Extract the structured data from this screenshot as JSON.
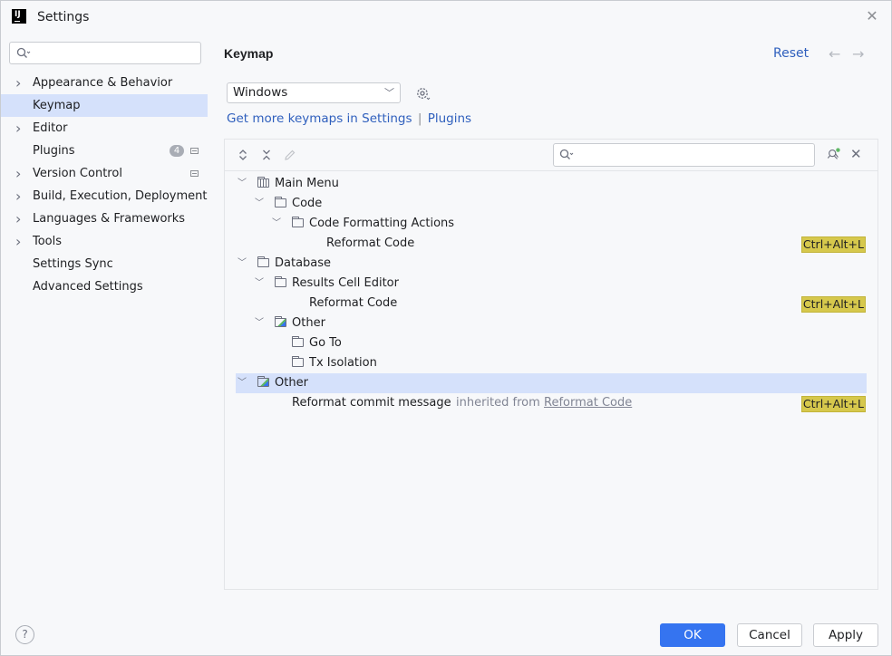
{
  "window": {
    "title": "Settings",
    "app_icon": "IJ"
  },
  "sidebar": {
    "search_placeholder": "",
    "items": [
      {
        "label": "Appearance & Behavior",
        "expandable": true
      },
      {
        "label": "Keymap",
        "selected": true
      },
      {
        "label": "Editor",
        "expandable": true
      },
      {
        "label": "Plugins",
        "badge": "4"
      },
      {
        "label": "Version Control",
        "expandable": true
      },
      {
        "label": "Build, Execution, Deployment",
        "expandable": true
      },
      {
        "label": "Languages & Frameworks",
        "expandable": true
      },
      {
        "label": "Tools",
        "expandable": true
      },
      {
        "label": "Settings Sync"
      },
      {
        "label": "Advanced Settings"
      }
    ]
  },
  "main": {
    "title": "Keymap",
    "reset_label": "Reset",
    "keymap_value": "Windows",
    "more_keymaps_text": "Get more keymaps in Settings",
    "plugins_link": "Plugins",
    "separator": "|"
  },
  "tree": [
    {
      "label": "Main Menu",
      "level": 0,
      "icon": "menu-folder-icon",
      "expanded": true
    },
    {
      "label": "Code",
      "level": 1,
      "icon": "folder-icon",
      "expanded": true
    },
    {
      "label": "Code Formatting Actions",
      "level": 2,
      "icon": "folder-icon",
      "expanded": true
    },
    {
      "label": "Reformat Code",
      "level": 3,
      "shortcut": "Ctrl+Alt+L"
    },
    {
      "label": "Database",
      "level": 0,
      "icon": "folder-icon",
      "expanded": true
    },
    {
      "label": "Results Cell Editor",
      "level": 1,
      "icon": "folder-icon",
      "expanded": true
    },
    {
      "label": "Reformat Code",
      "level": 2,
      "shortcut": "Ctrl+Alt+L"
    },
    {
      "label": "Other",
      "level": 1,
      "icon": "other-folder-icon",
      "expanded": true
    },
    {
      "label": "Go To",
      "level": 2,
      "icon": "folder-icon"
    },
    {
      "label": "Tx Isolation",
      "level": 2,
      "icon": "folder-icon"
    },
    {
      "label": "Other",
      "level": 0,
      "icon": "other-folder-icon",
      "expanded": true,
      "selected": true
    },
    {
      "label": "Reformat commit message",
      "level": 1,
      "note": "inherited from",
      "note_link": "Reformat Code",
      "shortcut": "Ctrl+Alt+L"
    }
  ],
  "footer": {
    "help": "?",
    "ok": "OK",
    "cancel": "Cancel",
    "apply": "Apply"
  },
  "colors": {
    "accent": "#3574f0",
    "selection": "#d5e1fb",
    "shortcut_highlight": "#d6c84c",
    "link": "#2f5fbd"
  }
}
